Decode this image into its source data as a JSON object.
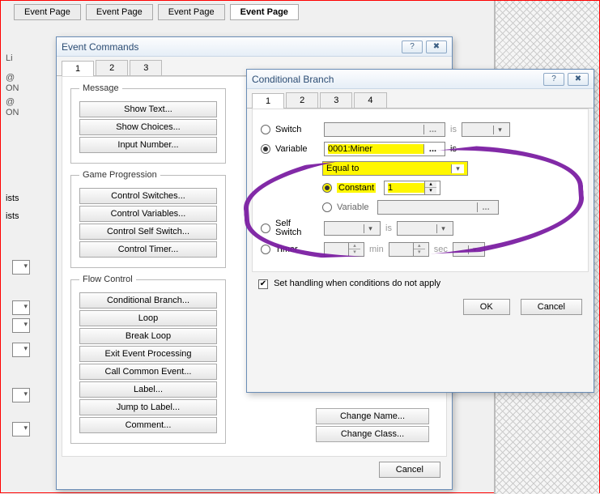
{
  "page_tabs": [
    "Event Page",
    "Event Page",
    "Event Page",
    "Event Page"
  ],
  "left_fragments": {
    "li": "Li",
    "on1": "ON",
    "on2": "ON",
    "at": "@",
    "ists1": "ists",
    "ists2": "ists"
  },
  "event_commands": {
    "title": "Event Commands",
    "tabs": [
      "1",
      "2",
      "3"
    ],
    "groups": {
      "message": {
        "legend": "Message",
        "items": [
          "Show Text...",
          "Show Choices...",
          "Input Number..."
        ]
      },
      "game_progression": {
        "legend": "Game Progression",
        "items": [
          "Control Switches...",
          "Control Variables...",
          "Control Self Switch...",
          "Control Timer..."
        ]
      },
      "flow_control": {
        "legend": "Flow Control",
        "items": [
          "Conditional Branch...",
          "Loop",
          "Break Loop",
          "Exit Event Processing",
          "Call Common Event...",
          "Label...",
          "Jump to Label...",
          "Comment..."
        ]
      }
    },
    "extra_buttons": [
      "Change Name...",
      "Change Class..."
    ],
    "cancel": "Cancel"
  },
  "conditional_branch": {
    "title": "Conditional Branch",
    "tabs": [
      "1",
      "2",
      "3",
      "4"
    ],
    "switch_label": "Switch",
    "switch_is": "is",
    "variable_label": "Variable",
    "variable_value": "0001:Miner",
    "variable_is": "is",
    "comparator": "Equal to",
    "constant_label": "Constant",
    "constant_value": "1",
    "sub_variable_label": "Variable",
    "self_switch_label": "Self Switch",
    "self_switch_is": "is",
    "timer_label": "Timer",
    "timer_min": "min",
    "timer_sec": "sec",
    "checkbox_label": "Set handling when conditions do not apply",
    "ok": "OK",
    "cancel": "Cancel"
  }
}
